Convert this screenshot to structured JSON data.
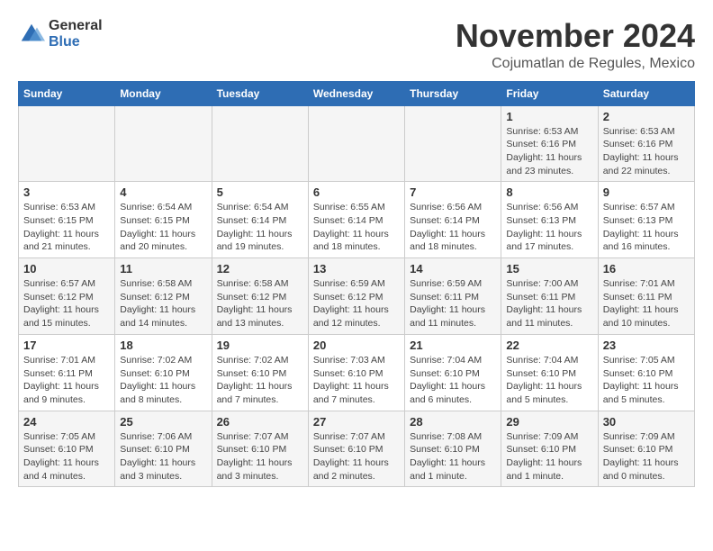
{
  "logo": {
    "general": "General",
    "blue": "Blue"
  },
  "title": "November 2024",
  "location": "Cojumatlan de Regules, Mexico",
  "days_header": [
    "Sunday",
    "Monday",
    "Tuesday",
    "Wednesday",
    "Thursday",
    "Friday",
    "Saturday"
  ],
  "weeks": [
    [
      {
        "day": "",
        "info": ""
      },
      {
        "day": "",
        "info": ""
      },
      {
        "day": "",
        "info": ""
      },
      {
        "day": "",
        "info": ""
      },
      {
        "day": "",
        "info": ""
      },
      {
        "day": "1",
        "info": "Sunrise: 6:53 AM\nSunset: 6:16 PM\nDaylight: 11 hours\nand 23 minutes."
      },
      {
        "day": "2",
        "info": "Sunrise: 6:53 AM\nSunset: 6:16 PM\nDaylight: 11 hours\nand 22 minutes."
      }
    ],
    [
      {
        "day": "3",
        "info": "Sunrise: 6:53 AM\nSunset: 6:15 PM\nDaylight: 11 hours\nand 21 minutes."
      },
      {
        "day": "4",
        "info": "Sunrise: 6:54 AM\nSunset: 6:15 PM\nDaylight: 11 hours\nand 20 minutes."
      },
      {
        "day": "5",
        "info": "Sunrise: 6:54 AM\nSunset: 6:14 PM\nDaylight: 11 hours\nand 19 minutes."
      },
      {
        "day": "6",
        "info": "Sunrise: 6:55 AM\nSunset: 6:14 PM\nDaylight: 11 hours\nand 18 minutes."
      },
      {
        "day": "7",
        "info": "Sunrise: 6:56 AM\nSunset: 6:14 PM\nDaylight: 11 hours\nand 18 minutes."
      },
      {
        "day": "8",
        "info": "Sunrise: 6:56 AM\nSunset: 6:13 PM\nDaylight: 11 hours\nand 17 minutes."
      },
      {
        "day": "9",
        "info": "Sunrise: 6:57 AM\nSunset: 6:13 PM\nDaylight: 11 hours\nand 16 minutes."
      }
    ],
    [
      {
        "day": "10",
        "info": "Sunrise: 6:57 AM\nSunset: 6:12 PM\nDaylight: 11 hours\nand 15 minutes."
      },
      {
        "day": "11",
        "info": "Sunrise: 6:58 AM\nSunset: 6:12 PM\nDaylight: 11 hours\nand 14 minutes."
      },
      {
        "day": "12",
        "info": "Sunrise: 6:58 AM\nSunset: 6:12 PM\nDaylight: 11 hours\nand 13 minutes."
      },
      {
        "day": "13",
        "info": "Sunrise: 6:59 AM\nSunset: 6:12 PM\nDaylight: 11 hours\nand 12 minutes."
      },
      {
        "day": "14",
        "info": "Sunrise: 6:59 AM\nSunset: 6:11 PM\nDaylight: 11 hours\nand 11 minutes."
      },
      {
        "day": "15",
        "info": "Sunrise: 7:00 AM\nSunset: 6:11 PM\nDaylight: 11 hours\nand 11 minutes."
      },
      {
        "day": "16",
        "info": "Sunrise: 7:01 AM\nSunset: 6:11 PM\nDaylight: 11 hours\nand 10 minutes."
      }
    ],
    [
      {
        "day": "17",
        "info": "Sunrise: 7:01 AM\nSunset: 6:11 PM\nDaylight: 11 hours\nand 9 minutes."
      },
      {
        "day": "18",
        "info": "Sunrise: 7:02 AM\nSunset: 6:10 PM\nDaylight: 11 hours\nand 8 minutes."
      },
      {
        "day": "19",
        "info": "Sunrise: 7:02 AM\nSunset: 6:10 PM\nDaylight: 11 hours\nand 7 minutes."
      },
      {
        "day": "20",
        "info": "Sunrise: 7:03 AM\nSunset: 6:10 PM\nDaylight: 11 hours\nand 7 minutes."
      },
      {
        "day": "21",
        "info": "Sunrise: 7:04 AM\nSunset: 6:10 PM\nDaylight: 11 hours\nand 6 minutes."
      },
      {
        "day": "22",
        "info": "Sunrise: 7:04 AM\nSunset: 6:10 PM\nDaylight: 11 hours\nand 5 minutes."
      },
      {
        "day": "23",
        "info": "Sunrise: 7:05 AM\nSunset: 6:10 PM\nDaylight: 11 hours\nand 5 minutes."
      }
    ],
    [
      {
        "day": "24",
        "info": "Sunrise: 7:05 AM\nSunset: 6:10 PM\nDaylight: 11 hours\nand 4 minutes."
      },
      {
        "day": "25",
        "info": "Sunrise: 7:06 AM\nSunset: 6:10 PM\nDaylight: 11 hours\nand 3 minutes."
      },
      {
        "day": "26",
        "info": "Sunrise: 7:07 AM\nSunset: 6:10 PM\nDaylight: 11 hours\nand 3 minutes."
      },
      {
        "day": "27",
        "info": "Sunrise: 7:07 AM\nSunset: 6:10 PM\nDaylight: 11 hours\nand 2 minutes."
      },
      {
        "day": "28",
        "info": "Sunrise: 7:08 AM\nSunset: 6:10 PM\nDaylight: 11 hours\nand 1 minute."
      },
      {
        "day": "29",
        "info": "Sunrise: 7:09 AM\nSunset: 6:10 PM\nDaylight: 11 hours\nand 1 minute."
      },
      {
        "day": "30",
        "info": "Sunrise: 7:09 AM\nSunset: 6:10 PM\nDaylight: 11 hours\nand 0 minutes."
      }
    ]
  ]
}
